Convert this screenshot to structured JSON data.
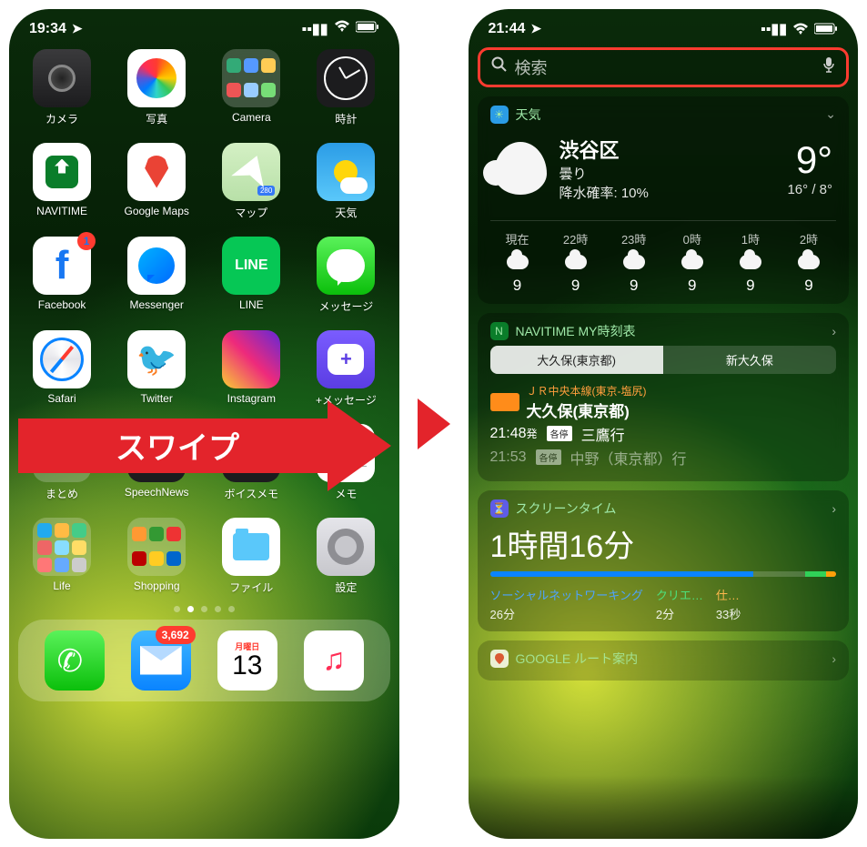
{
  "left": {
    "status": {
      "time": "19:34",
      "signal": ".ıl",
      "wifi": "wifi",
      "battery": "battery"
    },
    "apps": [
      {
        "label": "カメラ",
        "icon": "camera"
      },
      {
        "label": "写真",
        "icon": "photos"
      },
      {
        "label": "Camera",
        "icon": "folder"
      },
      {
        "label": "時計",
        "icon": "clock"
      },
      {
        "label": "NAVITIME",
        "icon": "navitime"
      },
      {
        "label": "Google Maps",
        "icon": "gmaps"
      },
      {
        "label": "マップ",
        "icon": "maps"
      },
      {
        "label": "天気",
        "icon": "weather"
      },
      {
        "label": "Facebook",
        "icon": "facebook",
        "badge": "1"
      },
      {
        "label": "Messenger",
        "icon": "messenger"
      },
      {
        "label": "LINE",
        "icon": "line"
      },
      {
        "label": "メッセージ",
        "icon": "messages"
      },
      {
        "label": "Safari",
        "icon": "safari"
      },
      {
        "label": "Twitter",
        "icon": "twitter"
      },
      {
        "label": "Instagram",
        "icon": "instagram"
      },
      {
        "label": "+メッセージ",
        "icon": "plusmsg"
      },
      {
        "label": "まとめ",
        "icon": "folder"
      },
      {
        "label": "SpeechNews",
        "icon": "wifi"
      },
      {
        "label": "ボイスメモ",
        "icon": "voice"
      },
      {
        "label": "メモ",
        "icon": "notes"
      },
      {
        "label": "Life",
        "icon": "folder"
      },
      {
        "label": "Shopping",
        "icon": "folder"
      },
      {
        "label": "ファイル",
        "icon": "files"
      },
      {
        "label": "設定",
        "icon": "settings"
      }
    ],
    "dock": [
      {
        "icon": "phone"
      },
      {
        "icon": "mail",
        "badge": "3,692"
      },
      {
        "icon": "calendar",
        "dow": "月曜日",
        "day": "13"
      },
      {
        "icon": "music"
      }
    ],
    "page_dots": {
      "count": 5,
      "active": 1
    }
  },
  "swipe_label": "スワイプ",
  "right": {
    "status": {
      "time": "21:44"
    },
    "search": {
      "placeholder": "検索"
    },
    "weather": {
      "title": "天気",
      "location": "渋谷区",
      "condition": "曇り",
      "precip_label": "降水確率: 10%",
      "temp": "9°",
      "range": "16° / 8°",
      "hourly": [
        {
          "t": "現在",
          "temp": "9"
        },
        {
          "t": "22時",
          "temp": "9"
        },
        {
          "t": "23時",
          "temp": "9"
        },
        {
          "t": "0時",
          "temp": "9"
        },
        {
          "t": "1時",
          "temp": "9"
        },
        {
          "t": "2時",
          "temp": "9"
        }
      ]
    },
    "navitime": {
      "title": "NAVITIME MY時刻表",
      "tabs": [
        "大久保(東京都)",
        "新大久保"
      ],
      "line": "ＪＲ中央本線(東京-塩尻)",
      "station": "大久保(東京都)",
      "dep1_time": "21:48",
      "dep1_suffix": "発",
      "dep1_type": "各停",
      "dep1_dest": "三鷹行",
      "dep2_time": "21:53",
      "dep2_type": "各停",
      "dep2_dest": "中野（東京都）行"
    },
    "screentime": {
      "title": "スクリーンタイム",
      "total": "1時間16分",
      "cats": [
        {
          "name": "ソーシャルネットワーキング",
          "val": "26分",
          "color": "n1"
        },
        {
          "name": "クリエ…",
          "val": "2分",
          "color": "n2"
        },
        {
          "name": "仕…",
          "val": "33秒",
          "color": "n3"
        }
      ]
    },
    "google_route": {
      "title": "GOOGLE ルート案内"
    }
  }
}
